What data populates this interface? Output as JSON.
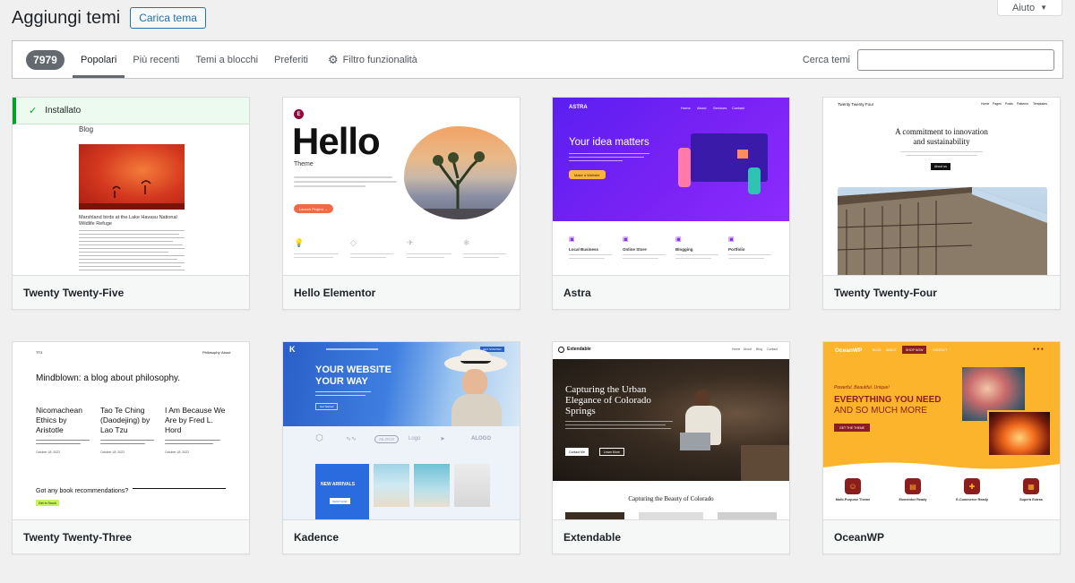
{
  "header": {
    "title": "Aggiungi temi",
    "upload_label": "Carica tema",
    "help_label": "Aiuto"
  },
  "filter": {
    "count": "7979",
    "tabs": [
      {
        "label": "Popolari",
        "active": true
      },
      {
        "label": "Più recenti",
        "active": false
      },
      {
        "label": "Temi a blocchi",
        "active": false
      },
      {
        "label": "Preferiti",
        "active": false
      }
    ],
    "feature_filter_label": "Filtro funzionalità",
    "search_label": "Cerca temi",
    "search_value": ""
  },
  "themes": [
    {
      "name": "Twenty Twenty-Five",
      "installed_label": "Installato",
      "preview": {
        "heading": "Blog",
        "caption": "Marshland birds at the Lake Havasu National Wildlife Refuge"
      }
    },
    {
      "name": "Hello Elementor",
      "preview": {
        "logo": "E",
        "title": "Hello",
        "subtitle": "Theme",
        "button": "Launch Project →"
      }
    },
    {
      "name": "Astra",
      "preview": {
        "brand": "ASTRA",
        "nav": [
          "Home",
          "About",
          "Services",
          "Contact"
        ],
        "headline": "Your idea matters",
        "button": "Make a Website",
        "features": [
          "Local Business",
          "Online Store",
          "Blogging",
          "Portfolio"
        ]
      }
    },
    {
      "name": "Twenty Twenty-Four",
      "preview": {
        "brand": "Twenty Twenty Four",
        "nav": [
          "Home",
          "Pages",
          "Posts",
          "Patterns",
          "Templates"
        ],
        "headline_1": "A commitment to innovation",
        "headline_2": "and sustainability",
        "button": "About us"
      }
    },
    {
      "name": "Twenty Twenty-Three",
      "preview": {
        "brand": "TT3",
        "nav": [
          "Philosophy",
          "About"
        ],
        "headline": "Mindblown: a blog about philosophy.",
        "posts": [
          {
            "title": "Nicomachean Ethics by Aristotle",
            "date": "October 18, 2022"
          },
          {
            "title": "Tao Te Ching (Daodejing) by Lao Tzu",
            "date": "October 18, 2022"
          },
          {
            "title": "I Am Because We Are by Fred L. Hord",
            "date": "October 18, 2022"
          }
        ],
        "question": "Got any book recommendations?",
        "button": "Get In Touch"
      }
    },
    {
      "name": "Kadence",
      "preview": {
        "headline_1": "YOUR WEBSITE",
        "headline_2": "YOUR WAY",
        "button": "Get Started",
        "cta": "GET STARTED",
        "logos": [
          "AILOGO",
          "Logo",
          "ALOGO"
        ],
        "new_arrivals": "NEW ARRIVALS",
        "shop_button": "SHOP NOW"
      }
    },
    {
      "name": "Extendable",
      "preview": {
        "brand": "Extendable",
        "nav": [
          "Home",
          "About",
          "Blog",
          "Contact"
        ],
        "headline_1": "Capturing the Urban",
        "headline_2": "Elegance of Colorado",
        "headline_3": "Springs",
        "button_1": "Contact Me",
        "button_2": "Learn More",
        "subhead": "Capturing the Beauty of Colorado"
      }
    },
    {
      "name": "OceanWP",
      "preview": {
        "brand": "OceanWP",
        "nav": [
          "BLOG",
          "ABOUT",
          "SHOP NOW",
          "CONTACT"
        ],
        "tagline": "Powerful. Beautiful. Unique!",
        "headline_1": "EVERYTHING YOU NEED",
        "headline_2": "AND SO MUCH MORE",
        "button": "GET THE THEME",
        "features": [
          "Multi-Purpose Theme",
          "Elementor Ready",
          "E-Commerce Ready",
          "Superb Extras"
        ]
      }
    }
  ],
  "colors": {
    "accent": "#2271b1",
    "installed_green": "#00a32a",
    "astra_purple": "#6b1bf2",
    "ocean_yellow": "#fbb42b"
  }
}
